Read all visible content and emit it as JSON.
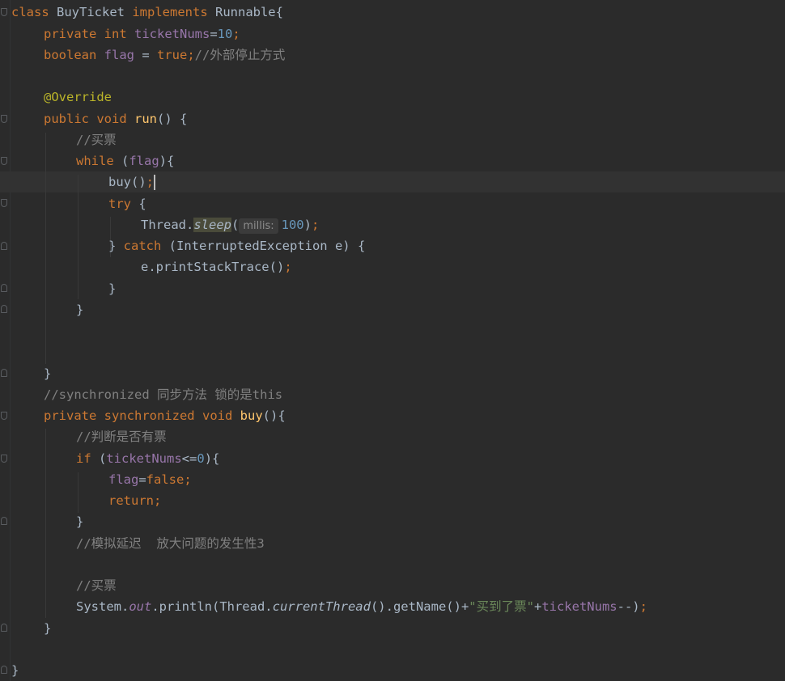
{
  "code": {
    "l01": {
      "kw_class": "class",
      "cls_name": " BuyTicket ",
      "kw_impl": "implements",
      "iface": " Runnable{"
    },
    "l02": {
      "kw_private": "private",
      "kw_int": " int ",
      "field": "ticketNums",
      "eq": "=",
      "value": "10",
      "semi": ";"
    },
    "l03": {
      "kw_boolean": "boolean",
      "field": " flag",
      "eq": " = ",
      "kw_true": "true",
      "semi": ";",
      "comment": "//外部停止方式"
    },
    "l04": {
      "annotation": "@Override"
    },
    "l05": {
      "kw_public": "public",
      "kw_void": " void ",
      "method": "run",
      "rest": "() {"
    },
    "l06": {
      "comment": "//买票"
    },
    "l07": {
      "kw_while": "while",
      "open": " (",
      "field": "flag",
      "close": "){"
    },
    "l08": {
      "call": "buy()",
      "semi": ";"
    },
    "l09": {
      "kw_try": "try",
      "rest": " {"
    },
    "l10": {
      "cls": "Thread.",
      "method": "sleep",
      "open": "(",
      "hint": "millis:",
      "value": "100",
      "close": ")",
      "semi": ";"
    },
    "l11": {
      "brace": "} ",
      "kw_catch": "catch",
      "rest": " (InterruptedException e) {"
    },
    "l12": {
      "call": "e.printStackTrace()",
      "semi": ";"
    },
    "l13": {
      "brace": "}"
    },
    "l14": {
      "brace": "}"
    },
    "l15": {
      "brace": "}"
    },
    "l16": {
      "comment": "//synchronized 同步方法 锁的是this"
    },
    "l17": {
      "kw_private": "private",
      "kw_sync": " synchronized",
      "kw_void": " void ",
      "method": "buy",
      "rest": "(){"
    },
    "l18": {
      "comment": "//判断是否有票"
    },
    "l19": {
      "kw_if": "if",
      "open": " (",
      "field": "ticketNums",
      "op": "<=",
      "value": "0",
      "close": "){"
    },
    "l20": {
      "field": "flag",
      "eq": "=",
      "kw_false": "false",
      "semi": ";"
    },
    "l21": {
      "kw_return": "return",
      "semi": ";"
    },
    "l22": {
      "brace": "}"
    },
    "l23": {
      "comment": "//模拟延迟  放大问题的发生性3"
    },
    "l24": {
      "comment": "//买票"
    },
    "l25": {
      "cls": "System.",
      "field_out": "out",
      "call1": ".println(Thread.",
      "method": "currentThread",
      "call2": "().getName()+",
      "str": "\"买到了票\"",
      "plus": "+",
      "field": "ticketNums",
      "post": "--)",
      "semi": ";"
    },
    "l26": {
      "brace": "}"
    },
    "l27": {
      "brace": "}"
    }
  }
}
